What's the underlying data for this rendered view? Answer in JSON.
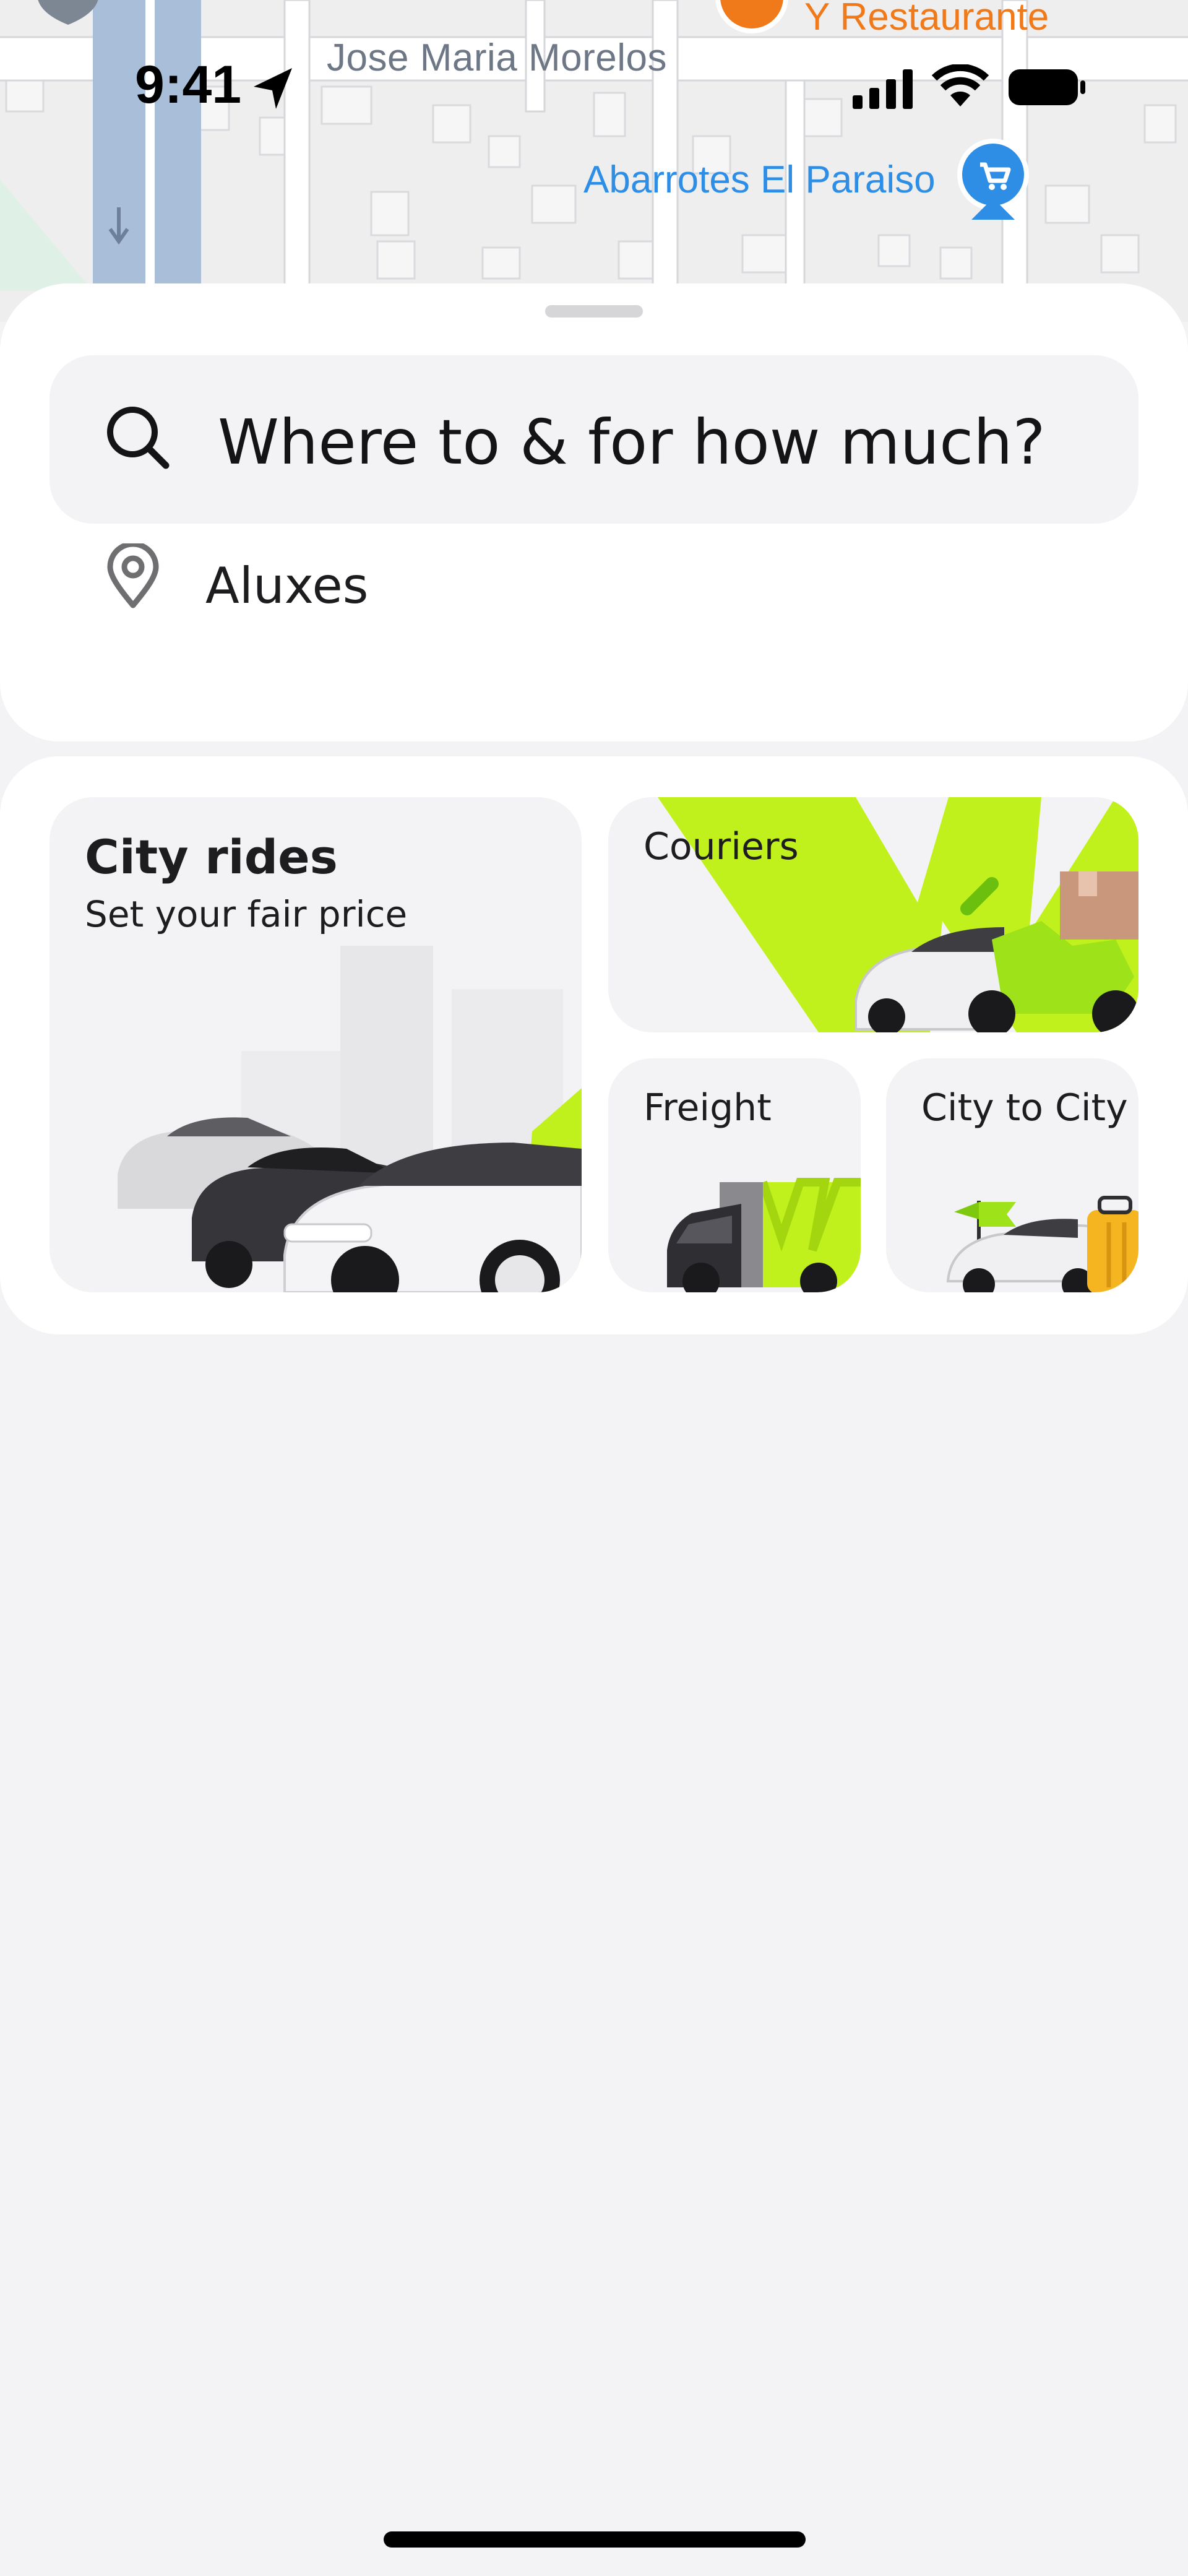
{
  "status_bar": {
    "time": "9:41",
    "icons": [
      "location-arrow-icon",
      "cellular-signal-icon",
      "wifi-icon",
      "battery-icon"
    ]
  },
  "map": {
    "street_label": "Jose Maria Morelos",
    "poi_restaurant_label": "Y Restaurante",
    "poi_store_label": "Abarrotes El Paraiso",
    "colors": {
      "restaurant": "#f07a1a",
      "store": "#2e8ee6",
      "road": "#a9bfd9"
    }
  },
  "search": {
    "placeholder": "Where to & for how much?",
    "icon": "search-icon"
  },
  "location": {
    "label": "Aluxes",
    "icon": "pin-icon"
  },
  "services": {
    "city_rides": {
      "title": "City rides",
      "subtitle": "Set your fair price"
    },
    "couriers": {
      "title": "Couriers"
    },
    "freight": {
      "title": "Freight"
    },
    "city_to_city": {
      "title": "City to City"
    }
  },
  "colors": {
    "accent": "#c1f11d",
    "sheet": "#ffffff",
    "background": "#f3f3f5"
  }
}
